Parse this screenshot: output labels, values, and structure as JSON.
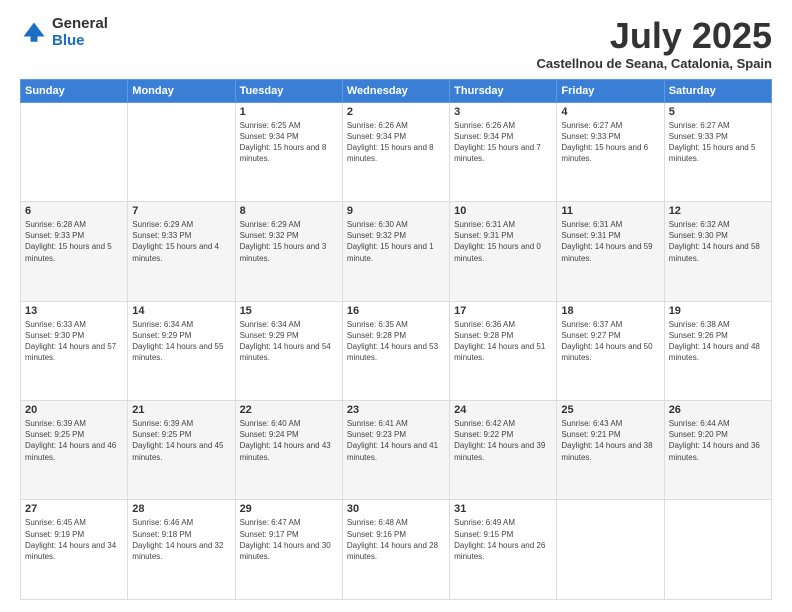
{
  "logo": {
    "general": "General",
    "blue": "Blue"
  },
  "title": "July 2025",
  "location": "Castellnou de Seana, Catalonia, Spain",
  "weekdays": [
    "Sunday",
    "Monday",
    "Tuesday",
    "Wednesday",
    "Thursday",
    "Friday",
    "Saturday"
  ],
  "weeks": [
    [
      {
        "day": "",
        "sunrise": "",
        "sunset": "",
        "daylight": ""
      },
      {
        "day": "",
        "sunrise": "",
        "sunset": "",
        "daylight": ""
      },
      {
        "day": "1",
        "sunrise": "Sunrise: 6:25 AM",
        "sunset": "Sunset: 9:34 PM",
        "daylight": "Daylight: 15 hours and 8 minutes."
      },
      {
        "day": "2",
        "sunrise": "Sunrise: 6:26 AM",
        "sunset": "Sunset: 9:34 PM",
        "daylight": "Daylight: 15 hours and 8 minutes."
      },
      {
        "day": "3",
        "sunrise": "Sunrise: 6:26 AM",
        "sunset": "Sunset: 9:34 PM",
        "daylight": "Daylight: 15 hours and 7 minutes."
      },
      {
        "day": "4",
        "sunrise": "Sunrise: 6:27 AM",
        "sunset": "Sunset: 9:33 PM",
        "daylight": "Daylight: 15 hours and 6 minutes."
      },
      {
        "day": "5",
        "sunrise": "Sunrise: 6:27 AM",
        "sunset": "Sunset: 9:33 PM",
        "daylight": "Daylight: 15 hours and 5 minutes."
      }
    ],
    [
      {
        "day": "6",
        "sunrise": "Sunrise: 6:28 AM",
        "sunset": "Sunset: 9:33 PM",
        "daylight": "Daylight: 15 hours and 5 minutes."
      },
      {
        "day": "7",
        "sunrise": "Sunrise: 6:29 AM",
        "sunset": "Sunset: 9:33 PM",
        "daylight": "Daylight: 15 hours and 4 minutes."
      },
      {
        "day": "8",
        "sunrise": "Sunrise: 6:29 AM",
        "sunset": "Sunset: 9:32 PM",
        "daylight": "Daylight: 15 hours and 3 minutes."
      },
      {
        "day": "9",
        "sunrise": "Sunrise: 6:30 AM",
        "sunset": "Sunset: 9:32 PM",
        "daylight": "Daylight: 15 hours and 1 minute."
      },
      {
        "day": "10",
        "sunrise": "Sunrise: 6:31 AM",
        "sunset": "Sunset: 9:31 PM",
        "daylight": "Daylight: 15 hours and 0 minutes."
      },
      {
        "day": "11",
        "sunrise": "Sunrise: 6:31 AM",
        "sunset": "Sunset: 9:31 PM",
        "daylight": "Daylight: 14 hours and 59 minutes."
      },
      {
        "day": "12",
        "sunrise": "Sunrise: 6:32 AM",
        "sunset": "Sunset: 9:30 PM",
        "daylight": "Daylight: 14 hours and 58 minutes."
      }
    ],
    [
      {
        "day": "13",
        "sunrise": "Sunrise: 6:33 AM",
        "sunset": "Sunset: 9:30 PM",
        "daylight": "Daylight: 14 hours and 57 minutes."
      },
      {
        "day": "14",
        "sunrise": "Sunrise: 6:34 AM",
        "sunset": "Sunset: 9:29 PM",
        "daylight": "Daylight: 14 hours and 55 minutes."
      },
      {
        "day": "15",
        "sunrise": "Sunrise: 6:34 AM",
        "sunset": "Sunset: 9:29 PM",
        "daylight": "Daylight: 14 hours and 54 minutes."
      },
      {
        "day": "16",
        "sunrise": "Sunrise: 6:35 AM",
        "sunset": "Sunset: 9:28 PM",
        "daylight": "Daylight: 14 hours and 53 minutes."
      },
      {
        "day": "17",
        "sunrise": "Sunrise: 6:36 AM",
        "sunset": "Sunset: 9:28 PM",
        "daylight": "Daylight: 14 hours and 51 minutes."
      },
      {
        "day": "18",
        "sunrise": "Sunrise: 6:37 AM",
        "sunset": "Sunset: 9:27 PM",
        "daylight": "Daylight: 14 hours and 50 minutes."
      },
      {
        "day": "19",
        "sunrise": "Sunrise: 6:38 AM",
        "sunset": "Sunset: 9:26 PM",
        "daylight": "Daylight: 14 hours and 48 minutes."
      }
    ],
    [
      {
        "day": "20",
        "sunrise": "Sunrise: 6:39 AM",
        "sunset": "Sunset: 9:25 PM",
        "daylight": "Daylight: 14 hours and 46 minutes."
      },
      {
        "day": "21",
        "sunrise": "Sunrise: 6:39 AM",
        "sunset": "Sunset: 9:25 PM",
        "daylight": "Daylight: 14 hours and 45 minutes."
      },
      {
        "day": "22",
        "sunrise": "Sunrise: 6:40 AM",
        "sunset": "Sunset: 9:24 PM",
        "daylight": "Daylight: 14 hours and 43 minutes."
      },
      {
        "day": "23",
        "sunrise": "Sunrise: 6:41 AM",
        "sunset": "Sunset: 9:23 PM",
        "daylight": "Daylight: 14 hours and 41 minutes."
      },
      {
        "day": "24",
        "sunrise": "Sunrise: 6:42 AM",
        "sunset": "Sunset: 9:22 PM",
        "daylight": "Daylight: 14 hours and 39 minutes."
      },
      {
        "day": "25",
        "sunrise": "Sunrise: 6:43 AM",
        "sunset": "Sunset: 9:21 PM",
        "daylight": "Daylight: 14 hours and 38 minutes."
      },
      {
        "day": "26",
        "sunrise": "Sunrise: 6:44 AM",
        "sunset": "Sunset: 9:20 PM",
        "daylight": "Daylight: 14 hours and 36 minutes."
      }
    ],
    [
      {
        "day": "27",
        "sunrise": "Sunrise: 6:45 AM",
        "sunset": "Sunset: 9:19 PM",
        "daylight": "Daylight: 14 hours and 34 minutes."
      },
      {
        "day": "28",
        "sunrise": "Sunrise: 6:46 AM",
        "sunset": "Sunset: 9:18 PM",
        "daylight": "Daylight: 14 hours and 32 minutes."
      },
      {
        "day": "29",
        "sunrise": "Sunrise: 6:47 AM",
        "sunset": "Sunset: 9:17 PM",
        "daylight": "Daylight: 14 hours and 30 minutes."
      },
      {
        "day": "30",
        "sunrise": "Sunrise: 6:48 AM",
        "sunset": "Sunset: 9:16 PM",
        "daylight": "Daylight: 14 hours and 28 minutes."
      },
      {
        "day": "31",
        "sunrise": "Sunrise: 6:49 AM",
        "sunset": "Sunset: 9:15 PM",
        "daylight": "Daylight: 14 hours and 26 minutes."
      },
      {
        "day": "",
        "sunrise": "",
        "sunset": "",
        "daylight": ""
      },
      {
        "day": "",
        "sunrise": "",
        "sunset": "",
        "daylight": ""
      }
    ]
  ]
}
